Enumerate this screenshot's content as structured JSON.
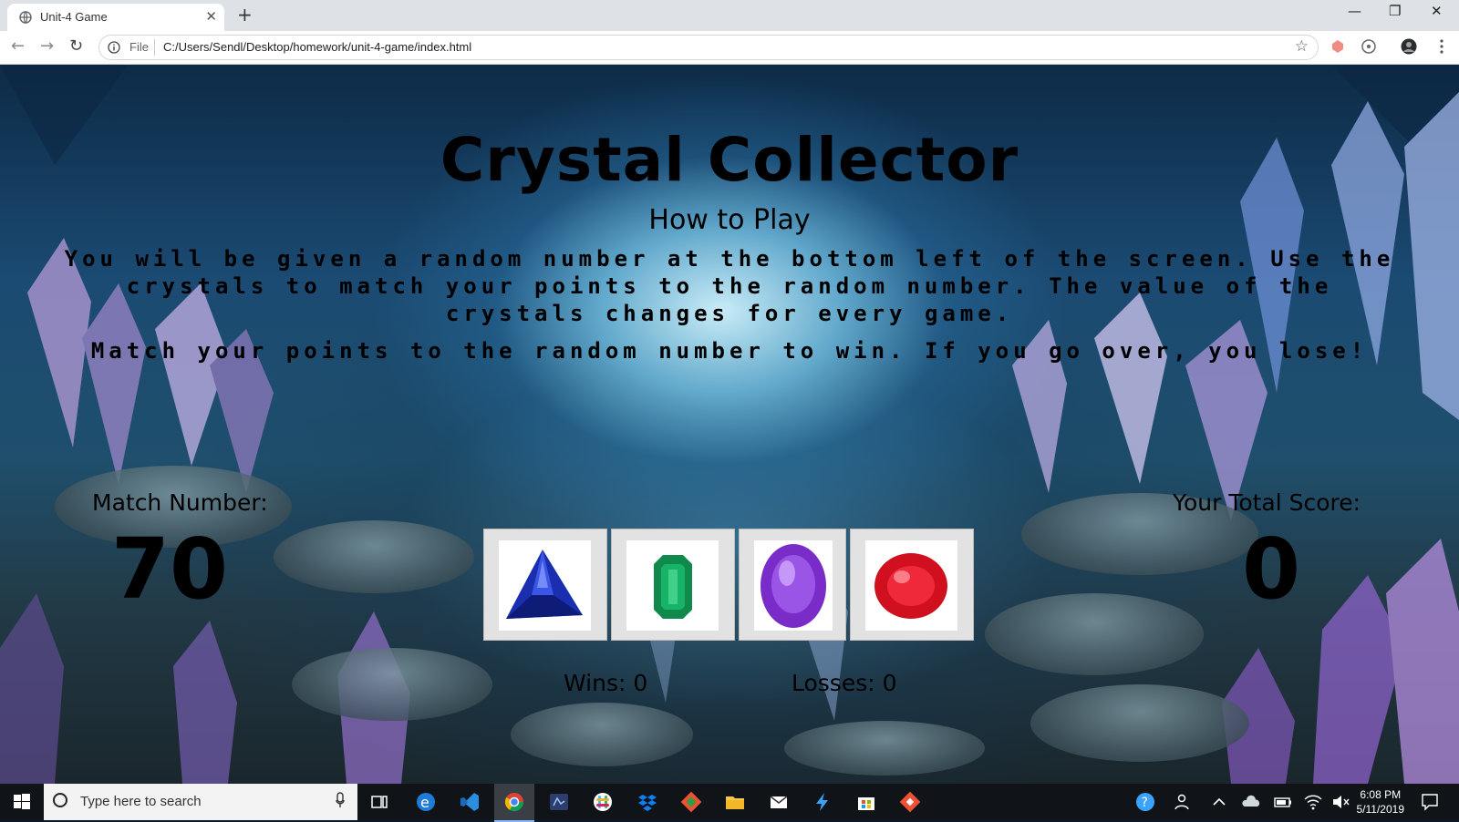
{
  "browser": {
    "tab_title": "Unit-4 Game",
    "tab_close": "✕",
    "new_tab": "+",
    "window_minimize": "—",
    "window_restore": "❐",
    "window_close": "✕",
    "scheme_label": "File",
    "url": "C:/Users/Sendl/Desktop/homework/unit-4-game/index.html",
    "bookmark_star": "☆",
    "back": "←",
    "forward": "→",
    "reload": "↻"
  },
  "game": {
    "title": "Crystal Collector",
    "how_to_play": "How to Play",
    "instructions_1": "You will be given a random number at the bottom left of the screen. Use the crystals to match your points to the random number. The value of the crystals changes for every game.",
    "instructions_2": "Match your points to the random number to win. If you go over, you lose!",
    "match_label": "Match Number:",
    "match_value": "70",
    "score_label": "Your Total Score:",
    "score_value": "0",
    "wins_label": "Wins: 0",
    "losses_label": "Losses: 0",
    "crystals": [
      {
        "name": "sapphire",
        "color": "#1a2fb0"
      },
      {
        "name": "emerald",
        "color": "#0f8a4c"
      },
      {
        "name": "amethyst",
        "color": "#7a2cc9"
      },
      {
        "name": "ruby",
        "color": "#d0101f"
      }
    ]
  },
  "taskbar": {
    "search_placeholder": "Type here to search",
    "time": "6:08 PM",
    "date": "5/11/2019"
  }
}
